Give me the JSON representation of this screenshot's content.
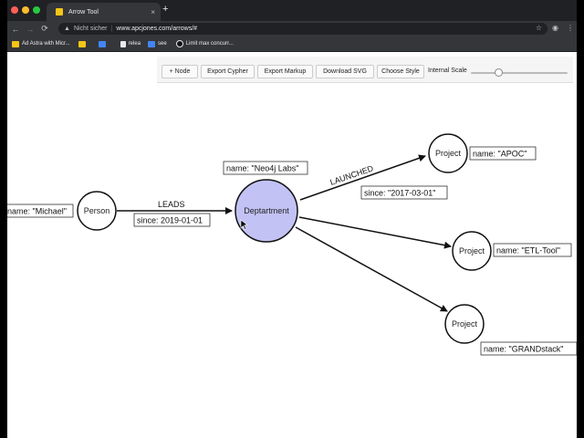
{
  "browser": {
    "tab_title": "Arrow Tool",
    "tab_close": "×",
    "new_tab": "+",
    "security_label": "Nicht sicher",
    "url": "www.apcjones.com/arrows/#",
    "bookmarks": [
      {
        "label": "Ad Astra with Micr...",
        "color": "#f5c518"
      },
      {
        "label": "",
        "color": "#f5c518"
      },
      {
        "label": "",
        "color": "#4285f4"
      },
      {
        "label": "relea",
        "color": "#e8eaed"
      },
      {
        "label": "see",
        "color": "#4285f4"
      },
      {
        "label": "Limit max concurr...",
        "color": "#111111"
      }
    ]
  },
  "app": {
    "buttons": {
      "node": "+ Node",
      "export_cypher": "Export Cypher",
      "export_markup": "Export Markup",
      "download_svg": "Download SVG",
      "choose_style": "Choose Style"
    },
    "scale_label": "Internal Scale",
    "scale_value": 0.25
  },
  "graph": {
    "nodes": {
      "person": {
        "label": "Person",
        "prop": "name: \"Michael\""
      },
      "department": {
        "label": "Deptartment",
        "prop": "name: \"Neo4j Labs\"",
        "fill": "#c2c2f5"
      },
      "project_apoc": {
        "label": "Project",
        "prop": "name: \"APOC\""
      },
      "project_etl": {
        "label": "Project",
        "prop": "name: \"ETL-Tool\""
      },
      "project_grand": {
        "label": "Project",
        "prop": "name: \"GRANDstack\""
      }
    },
    "relationships": {
      "leads": {
        "type": "LEADS",
        "prop": "since: 2019-01-01"
      },
      "launched": {
        "type": "LAUNCHED",
        "prop": "since: \"2017-03-01\""
      }
    }
  }
}
